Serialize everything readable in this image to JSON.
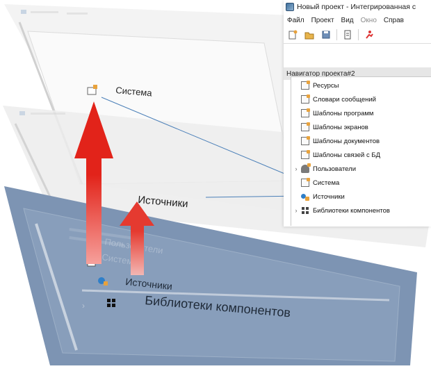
{
  "window": {
    "title": "Новый проект - Интегрированная с",
    "menu": [
      "Файл",
      "Проект",
      "Вид",
      "Окно",
      "Справ"
    ],
    "panel_title": "Навигатор проекта#2"
  },
  "toolbar": {
    "icons": [
      "new-file-icon",
      "open-folder-icon",
      "save-icon",
      "document-icon",
      "run-icon"
    ]
  },
  "navigator_tools": {
    "icons": [
      "add-dropdown-icon",
      "delete-icon",
      "undo-icon",
      "redo-icon",
      "copy-icon",
      "paste-icon"
    ],
    "glyphs": {
      "delete": "✕",
      "undo": "↶",
      "redo": "↷"
    }
  },
  "tree": {
    "items": [
      {
        "label": "Ресурсы",
        "icon": "resources-icon",
        "expandable": false
      },
      {
        "label": "Словари сообщений",
        "icon": "dictionaries-icon",
        "expandable": false
      },
      {
        "label": "Шаблоны программ",
        "icon": "program-templates-icon",
        "expandable": false
      },
      {
        "label": "Шаблоны экранов",
        "icon": "screen-templates-icon",
        "expandable": false
      },
      {
        "label": "Шаблоны документов",
        "icon": "document-templates-icon",
        "expandable": false
      },
      {
        "label": "Шаблоны связей с БД",
        "icon": "db-templates-icon",
        "expandable": false
      },
      {
        "label": "Пользователи",
        "icon": "users-icon",
        "expandable": true
      },
      {
        "label": "Система",
        "icon": "system-icon",
        "expandable": false
      },
      {
        "label": "Источники",
        "icon": "sources-icon",
        "expandable": false
      },
      {
        "label": "Библиотеки компонентов",
        "icon": "libraries-icon",
        "expandable": true
      }
    ],
    "expander_glyph": "›"
  },
  "layers": {
    "top_label": "Система",
    "middle_label": "Источники",
    "bottom_items": [
      "Источники",
      "Библиотеки компонентов"
    ],
    "bottom_faint_items": [
      "Пользователи",
      "Система"
    ]
  },
  "colors": {
    "plane_light": "#f0f0f0",
    "plane_blue": "#7d94b3",
    "arrow_red": "#e2231a",
    "leader_line": "#4a7fb8"
  }
}
